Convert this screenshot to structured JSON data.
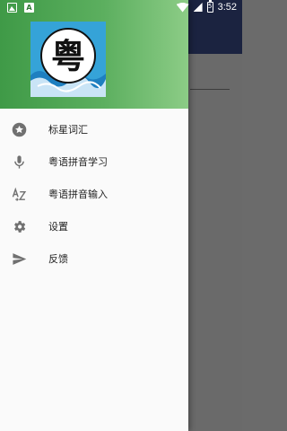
{
  "status_bar": {
    "time": "3:52",
    "battery_level": "5",
    "left_icons": [
      "image-notification-icon",
      "a-notification-icon"
    ],
    "right_icons": [
      "wifi-icon",
      "cell-signal-icon",
      "battery-icon"
    ]
  },
  "drawer": {
    "header": {
      "logo_char": "粤"
    },
    "items": [
      {
        "icon": "star-icon",
        "label": "标星词汇"
      },
      {
        "icon": "microphone-icon",
        "label": "粤语拼音学习"
      },
      {
        "icon": "a-z-sort-icon",
        "label": "粤语拼音输入"
      },
      {
        "icon": "gear-icon",
        "label": "设置"
      },
      {
        "icon": "send-icon",
        "label": "反馈"
      }
    ]
  },
  "colors": {
    "header_green_start": "#3f9a47",
    "header_green_end": "#8ccc86",
    "toolbar_navy": "#1b2340",
    "scrim_gray": "#6a6a6a",
    "icon_gray": "#707070"
  }
}
